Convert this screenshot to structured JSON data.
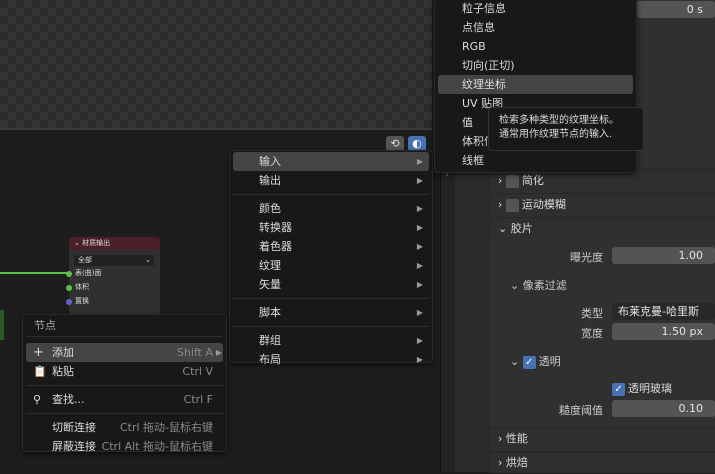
{
  "timeline": {
    "time_value": "0 s"
  },
  "node": {
    "title": "材质输出",
    "target": "全部",
    "sockets": [
      "表(曲)面",
      "体积",
      "置换"
    ]
  },
  "context_menu": {
    "title": "节点",
    "items": [
      {
        "label": "添加",
        "shortcut": "Shift A"
      },
      {
        "label": "粘贴",
        "shortcut": "Ctrl V"
      },
      {
        "label": "查找...",
        "shortcut": "Ctrl F"
      },
      {
        "label": "切断连接",
        "shortcut": "Ctrl 拖动-鼠标右键"
      },
      {
        "label": "屏蔽连接",
        "shortcut": "Ctrl Alt 拖动-鼠标右键"
      }
    ]
  },
  "add_menu": {
    "items": [
      "输入",
      "输出",
      "颜色",
      "转换器",
      "着色器",
      "纹理",
      "矢量",
      "脚本",
      "群组",
      "布局"
    ]
  },
  "input_submenu": {
    "items": [
      "粒子信息",
      "点信息",
      "RGB",
      "切向(正切)",
      "纹理坐标",
      "UV 贴图",
      "值",
      "体积信息",
      "线框"
    ],
    "highlighted": "纹理坐标"
  },
  "tooltip": {
    "line1": "检索多种类型的纹理坐标。",
    "line2": "通常用作纹理节点的输入."
  },
  "properties": {
    "simplify": "简化",
    "motion_blur": "运动模糊",
    "film": "胶片",
    "exposure_label": "曝光度",
    "exposure": "1.00",
    "pixel_filter": "像素过滤",
    "type_label": "类型",
    "type_value": "布莱克曼-哈里斯",
    "width_label": "宽度",
    "width_value": "1.50 px",
    "transparent": "透明",
    "transparent_glass": "透明玻璃",
    "roughness_label": "糙度阈值",
    "roughness": "0.10",
    "performance": "性能",
    "bake": "烘焙"
  },
  "colors": {
    "accent": "#4772b3",
    "highlight": "#444444"
  }
}
